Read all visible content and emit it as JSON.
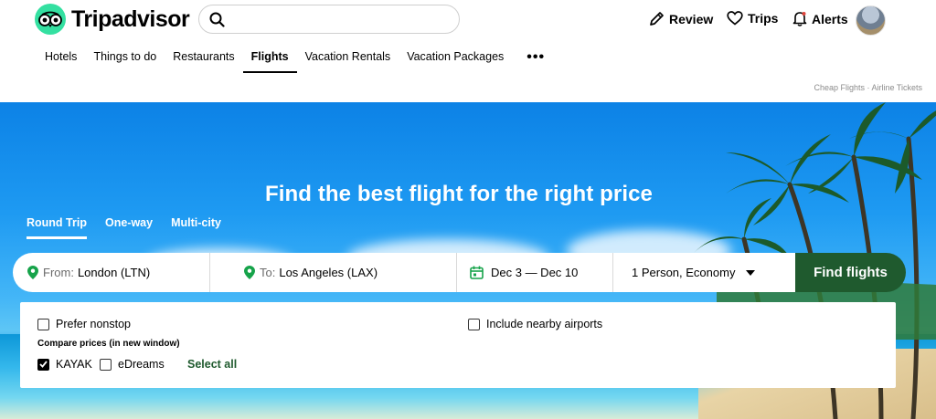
{
  "brand": {
    "name": "Tripadvisor",
    "accent": "#34e0a1",
    "dark_green": "#1f5a2e"
  },
  "search": {
    "placeholder": "",
    "value": ""
  },
  "header_actions": [
    {
      "label": "Review",
      "icon": "pencil-icon"
    },
    {
      "label": "Trips",
      "icon": "heart-icon"
    },
    {
      "label": "Alerts",
      "icon": "bell-icon"
    }
  ],
  "nav": {
    "items": [
      "Hotels",
      "Things to do",
      "Restaurants",
      "Flights",
      "Vacation Rentals",
      "Vacation Packages"
    ],
    "active": "Flights",
    "more_icon": "more-dots-icon"
  },
  "top_links": "Cheap Flights · Airline Tickets",
  "hero": {
    "title": "Find the best flight for the right price",
    "trip_types": [
      "Round Trip",
      "One-way",
      "Multi-city"
    ],
    "active_trip_type": "Round Trip"
  },
  "form": {
    "from_label": "From:",
    "from_value": "London (LTN)",
    "to_label": "To:",
    "to_value": "Los Angeles (LAX)",
    "dates": "Dec 3 — Dec 10",
    "travelers": "1 Person, Economy",
    "submit": "Find flights"
  },
  "options": {
    "prefer_nonstop": {
      "label": "Prefer nonstop",
      "checked": false
    },
    "nearby_airports": {
      "label": "Include nearby airports",
      "checked": false
    },
    "compare_label": "Compare prices (in new window)",
    "providers": [
      {
        "label": "KAYAK",
        "checked": true
      },
      {
        "label": "eDreams",
        "checked": false
      }
    ],
    "select_all": "Select all"
  }
}
